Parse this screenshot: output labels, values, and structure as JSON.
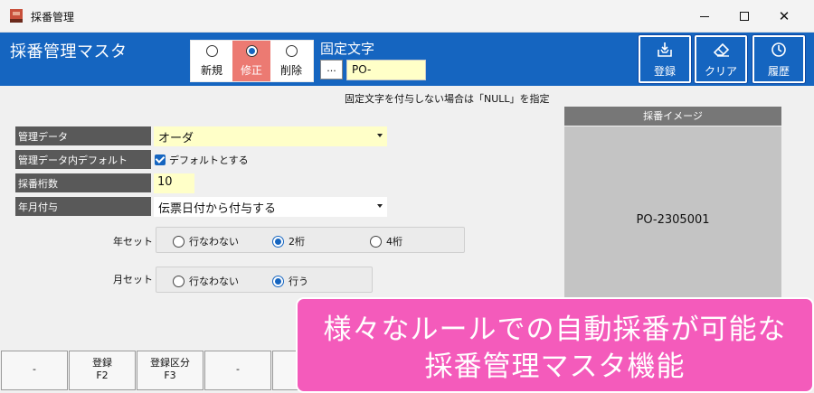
{
  "window": {
    "title": "採番管理"
  },
  "header": {
    "screen_title": "採番管理マスタ",
    "modes": [
      {
        "label": "新規",
        "selected": false
      },
      {
        "label": "修正",
        "selected": true
      },
      {
        "label": "削除",
        "selected": false
      }
    ],
    "fixed_text_label": "固定文字",
    "fixed_text_button": "...",
    "fixed_text_value": "PO-",
    "toolbar": [
      {
        "label": "登録",
        "icon": "inbox-download-icon"
      },
      {
        "label": "クリア",
        "icon": "eraser-icon"
      },
      {
        "label": "履歴",
        "icon": "clock-icon"
      }
    ]
  },
  "hint": "固定文字を付与しない場合は「NULL」を指定",
  "form": {
    "managed_data": {
      "label": "管理データ",
      "value": "オーダ"
    },
    "default": {
      "label": "管理データ内デフォルト",
      "checkbox_label": "デフォルトとする",
      "checked": true
    },
    "digits": {
      "label": "採番桁数",
      "value": "10"
    },
    "date_append": {
      "label": "年月付与",
      "value": "伝票日付から付与する"
    }
  },
  "year_set": {
    "label": "年セット",
    "options": [
      {
        "label": "行なわない",
        "selected": false
      },
      {
        "label": "2桁",
        "selected": true
      },
      {
        "label": "4桁",
        "selected": false
      }
    ]
  },
  "month_set": {
    "label": "月セット",
    "options": [
      {
        "label": "行なわない",
        "selected": false
      },
      {
        "label": "行う",
        "selected": true
      }
    ]
  },
  "preview": {
    "header": "採番イメージ",
    "value": "PO-2305001"
  },
  "function_keys": [
    {
      "line1": "-",
      "line2": ""
    },
    {
      "line1": "登録",
      "line2": "F2"
    },
    {
      "line1": "登録区分",
      "line2": "F3"
    },
    {
      "line1": "-",
      "line2": ""
    }
  ],
  "banner": {
    "line1": "様々なルールでの自動採番が可能な",
    "line2": "採番管理マスタ機能"
  },
  "colors": {
    "header_blue": "#1565c0",
    "selected_mode": "#ec7a72",
    "input_yellow": "#ffffc8",
    "label_gray": "#595959",
    "banner_pink": "#f45bbb"
  }
}
